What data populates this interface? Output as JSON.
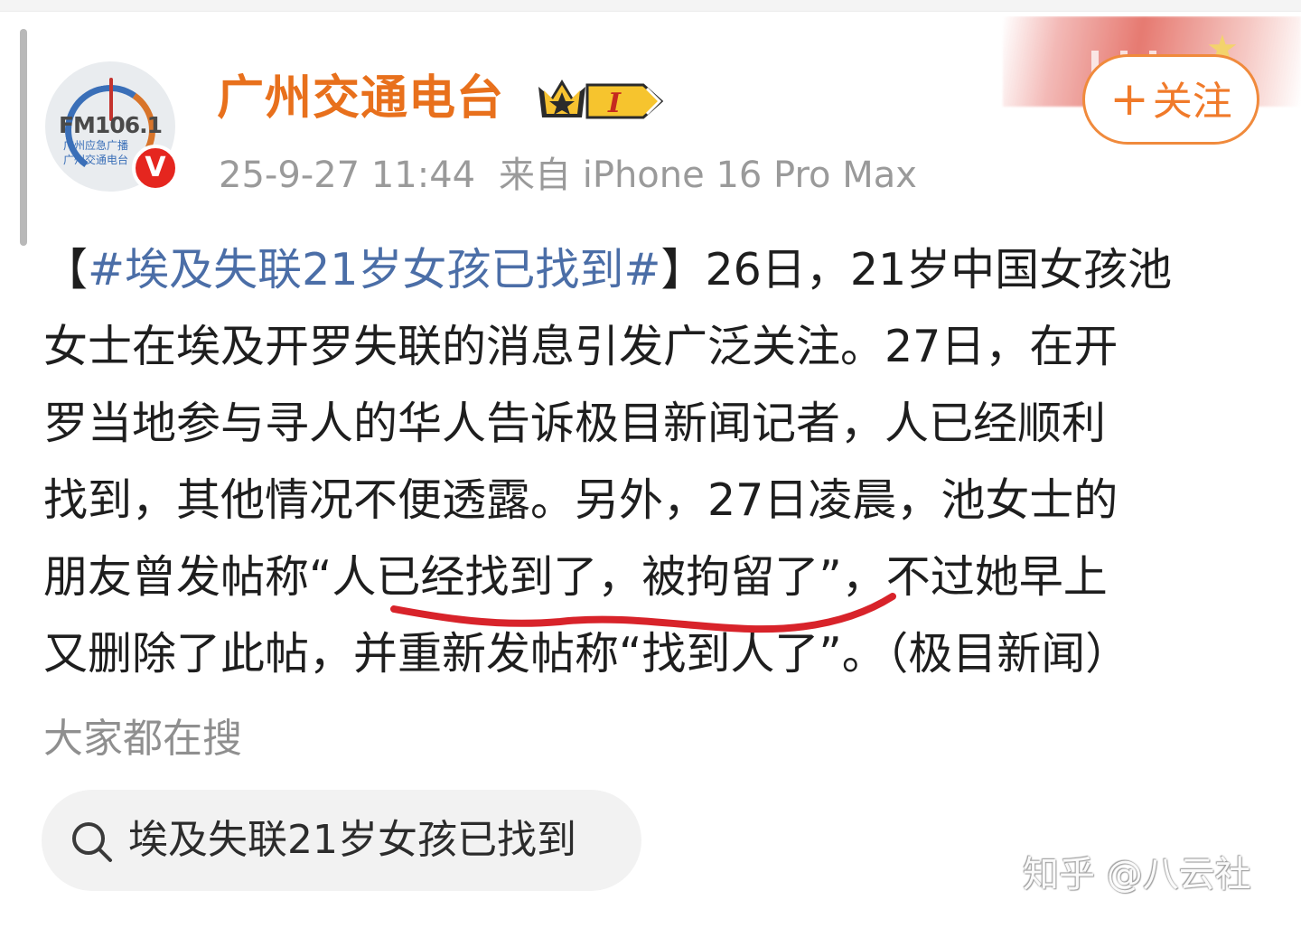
{
  "post": {
    "account_name": "广州交通电台",
    "avatar": {
      "frequency": "FM106.1",
      "line1": "广州应急广播",
      "line2": "广州交通电台"
    },
    "verified_badge": "V",
    "level_badge": "I",
    "timestamp": "25-9-27 11:44",
    "source": "来自 iPhone 16 Pro Max",
    "follow_label": "关注",
    "follow_plus": "+",
    "text": {
      "bracket_open": "【",
      "hashtag": "#埃及失联21岁女孩已找到#",
      "line1_rest": "】26日，21岁中国女孩池",
      "line2": "女士在埃及开罗失联的消息引发广泛关注。27日，在开",
      "line3": "罗当地参与寻人的华人告诉极目新闻记者，人已经顺利",
      "line4": "找到，其他情况不便透露。另外，27日凌晨，池女士的",
      "line5": "朋友曾发帖称“人已经找到了，被拘留了”，不过她早上",
      "line6": "又删除了此帖，并重新发帖称“找到人了”。（极目新闻）"
    }
  },
  "trending": {
    "title": "大家都在搜",
    "search_query": "埃及失联21岁女孩已找到"
  },
  "watermark": "知乎 @八云社",
  "colors": {
    "account_name": "#e8701c",
    "hashtag": "#4b6ea7",
    "follow_border": "#f08a3c",
    "verified_badge": "#e5261f",
    "annotation_underline": "#d8232a"
  },
  "icons": {
    "search": "search-icon",
    "crown": "crown-badge-icon",
    "verified": "verified-v-icon"
  }
}
